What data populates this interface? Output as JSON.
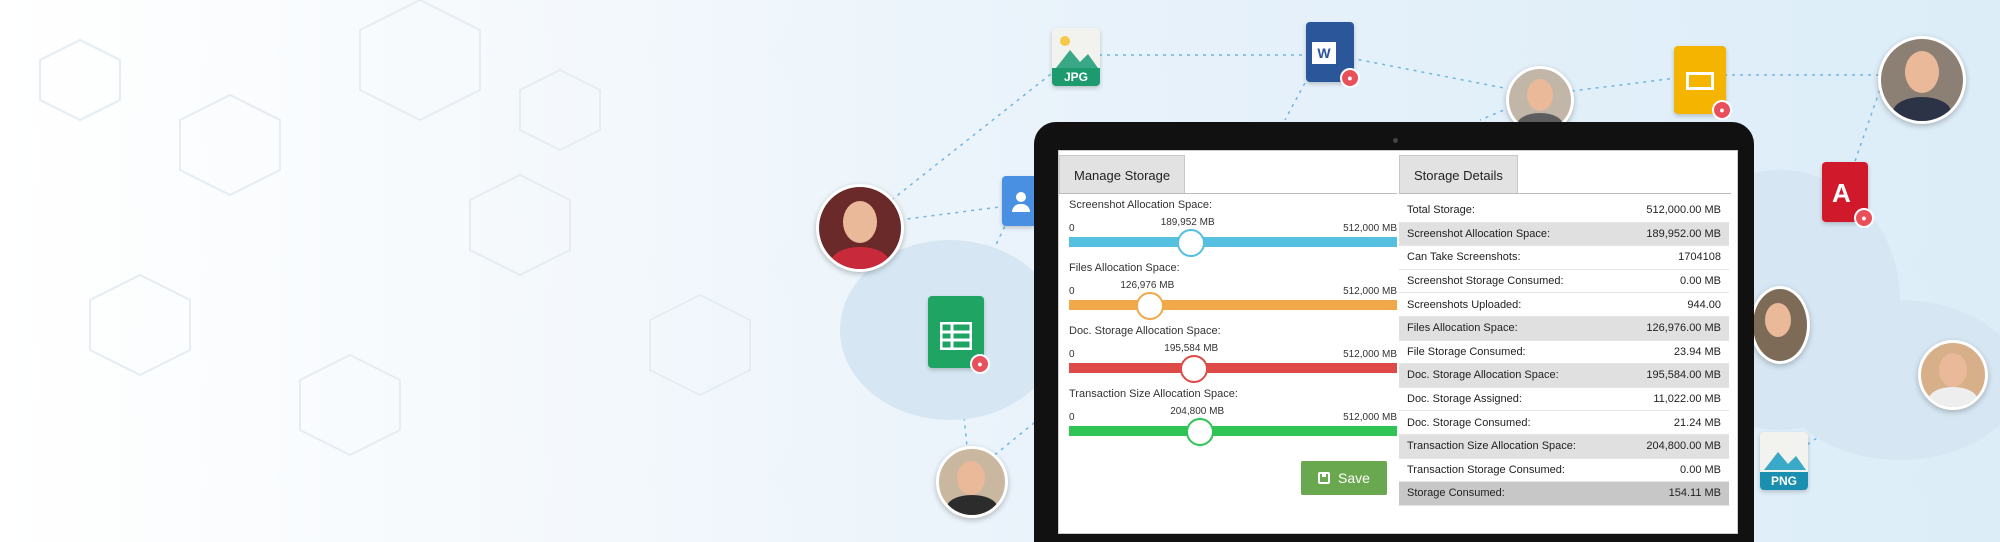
{
  "manage_storage": {
    "title": "Manage Storage",
    "save_label": "Save",
    "sliders": [
      {
        "label": "Screenshot Allocation Space:",
        "min_label": "0",
        "max_label": "512,000 MB",
        "value_label": "189,952 MB",
        "value": 189952,
        "max": 512000,
        "color": "#55bfe0"
      },
      {
        "label": "Files Allocation Space:",
        "min_label": "0",
        "max_label": "512,000 MB",
        "value_label": "126,976 MB",
        "value": 126976,
        "max": 512000,
        "color": "#f0a848"
      },
      {
        "label": "Doc. Storage Allocation Space:",
        "min_label": "0",
        "max_label": "512,000 MB",
        "value_label": "195,584 MB",
        "value": 195584,
        "max": 512000,
        "color": "#de4a48"
      },
      {
        "label": "Transaction Size Allocation Space:",
        "min_label": "0",
        "max_label": "512,000 MB",
        "value_label": "204,800 MB",
        "value": 204800,
        "max": 512000,
        "color": "#2fc455"
      }
    ]
  },
  "storage_details": {
    "title": "Storage Details",
    "rows": [
      {
        "label": "Total Storage:",
        "value": "512,000.00 MB",
        "style": "plain"
      },
      {
        "label": "Screenshot Allocation Space:",
        "value": "189,952.00 MB",
        "style": "shade"
      },
      {
        "label": "Can Take Screenshots:",
        "value": "1704108",
        "style": "plain"
      },
      {
        "label": "Screenshot Storage Consumed:",
        "value": "0.00 MB",
        "style": "plain"
      },
      {
        "label": "Screenshots Uploaded:",
        "value": "944.00",
        "style": "plain"
      },
      {
        "label": "Files Allocation Space:",
        "value": "126,976.00 MB",
        "style": "shade"
      },
      {
        "label": "File Storage Consumed:",
        "value": "23.94 MB",
        "style": "plain"
      },
      {
        "label": "Doc. Storage Allocation Space:",
        "value": "195,584.00 MB",
        "style": "shade"
      },
      {
        "label": "Doc. Storage Assigned:",
        "value": "11,022.00 MB",
        "style": "plain"
      },
      {
        "label": "Doc. Storage Consumed:",
        "value": "21.24 MB",
        "style": "plain"
      },
      {
        "label": "Transaction Size Allocation Space:",
        "value": "204,800.00 MB",
        "style": "shade"
      },
      {
        "label": "Transaction Storage Consumed:",
        "value": "0.00 MB",
        "style": "plain"
      },
      {
        "label": "Storage Consumed:",
        "value": "154.11 MB",
        "style": "total"
      }
    ]
  },
  "floating_icons": {
    "jpg_label": "JPG",
    "png_label": "PNG",
    "word_label": "W",
    "icons": [
      "jpg-file-icon",
      "word-file-icon",
      "slides-file-icon",
      "pdf-file-icon",
      "contacts-file-icon",
      "sheets-file-icon",
      "png-file-icon",
      "lock-badge-icon"
    ]
  },
  "colors": {
    "save_button": "#6aa84f",
    "shade_row": "#e0e0e0",
    "total_row": "#c7c7c7"
  }
}
